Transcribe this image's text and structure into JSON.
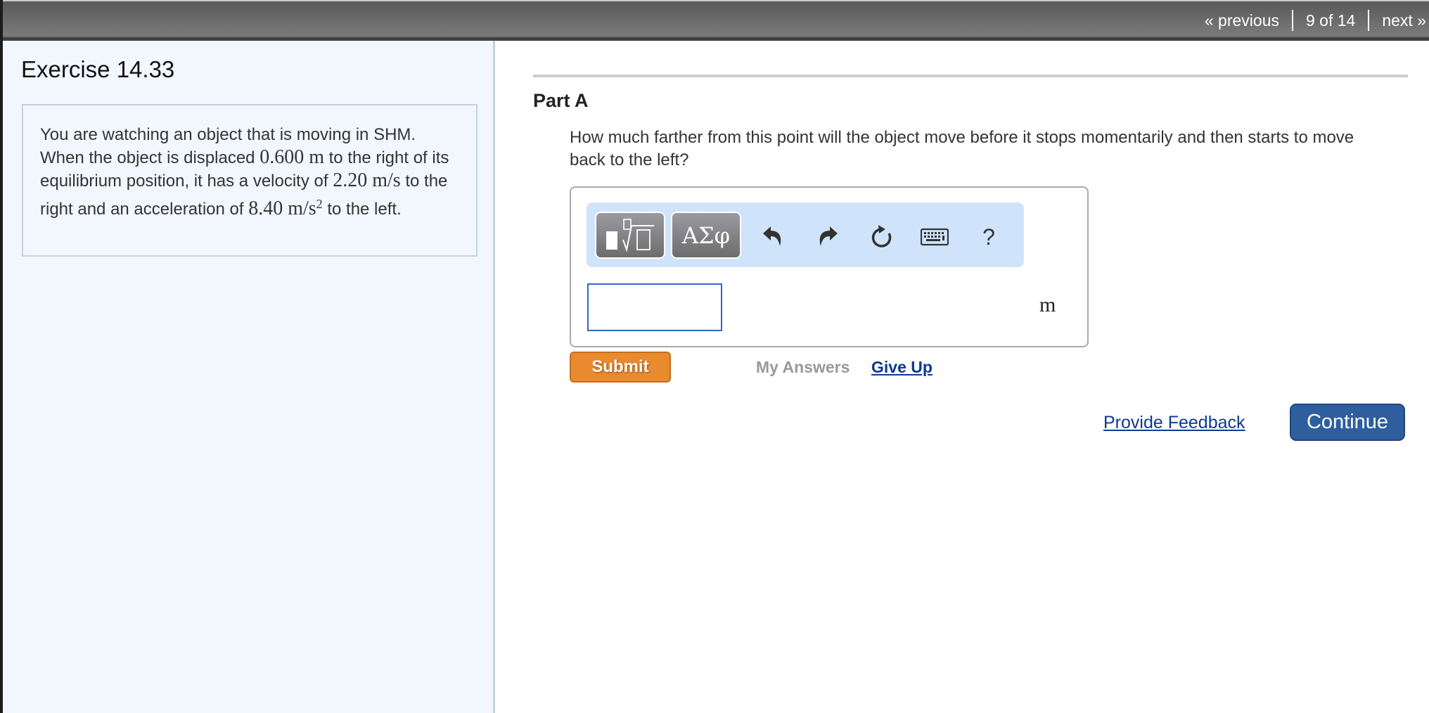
{
  "topnav": {
    "previous_label": "« previous",
    "position_label": "9 of 14",
    "next_label": "next »"
  },
  "sidebar": {
    "exercise_title": "Exercise 14.33",
    "problem": {
      "text_1": "You are watching an object that is moving in SHM. When the object is displaced ",
      "displacement": "0.600 m",
      "text_2": " to the right of its equilibrium position, it has a velocity of ",
      "velocity": "2.20 m/s",
      "text_3": " to the right and an acceleration of ",
      "acceleration_value": "8.40 m/s",
      "acceleration_exponent": "2",
      "text_4": " to the left."
    }
  },
  "main": {
    "part_title": "Part A",
    "question": "How much farther from this point will the object move before it stops momentarily and then starts to move back to the left?",
    "toolbar": {
      "templates_icon": "templates-icon",
      "symbols_label": "ΑΣφ",
      "undo_icon": "undo-icon",
      "redo_icon": "redo-icon",
      "reset_icon": "reset-icon",
      "keyboard_icon": "keyboard-icon",
      "help_label": "?"
    },
    "answer": {
      "value": "",
      "placeholder": "",
      "unit": "m"
    },
    "submit_label": "Submit",
    "my_answers_label": "My Answers",
    "give_up_label": "Give Up",
    "feedback_label": "Provide Feedback",
    "continue_label": "Continue"
  },
  "colors": {
    "submit": "#ea8a2f",
    "continue": "#2e5e9e",
    "link": "#0a3a93",
    "toolbar_bg": "#cfe4fb",
    "sidebar_bg": "#f2f7fe"
  }
}
